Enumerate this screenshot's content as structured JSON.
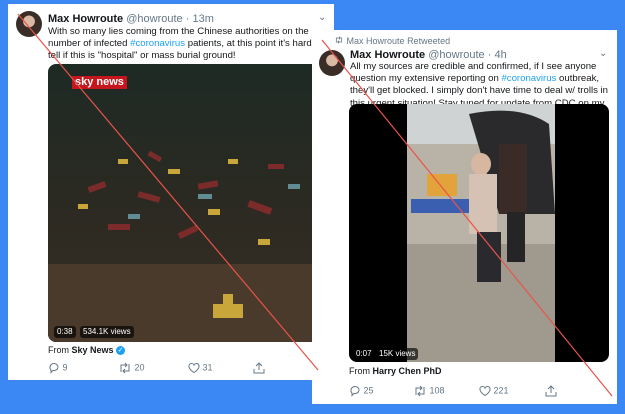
{
  "tweet1": {
    "author_name": "Max Howroute",
    "handle": "@howroute",
    "separator": "·",
    "time": "13m",
    "text_before": "With so many lies coming from the Chinese authorities on the number of infected ",
    "hashtag": "#coronavirus",
    "text_after": " patients, at this point it's hard to tell if this is \"hospital\" or mass burial ground!",
    "video_logo": "sky news",
    "video_duration": "0:38",
    "video_views": "534.1K views",
    "from_label": "From",
    "from_source": "Sky News",
    "verified_glyph": "✓",
    "replies": "9",
    "retweets": "20",
    "likes": "31"
  },
  "tweet2": {
    "retweet_label": "Max Howroute",
    "retweet_suffix": "Retweeted",
    "author_name": "Max Howroute",
    "handle": "@howroute",
    "separator": "·",
    "time": "4h",
    "text_before": "All my sources are credible and confirmed, if I see anyone question my extensive reporting on ",
    "hashtag": "#coronavirus",
    "text_after": " outbreak, they'll get blocked. I simply don't have time to deal w/ trolls in this urgent situation! Stay tuned for update from CDC on my main thread.",
    "video_duration": "0:07",
    "video_views": "15K views",
    "from_label": "From",
    "from_source": "Harry Chen PhD",
    "replies": "25",
    "retweets": "108",
    "likes": "221"
  },
  "colors": {
    "background": "#3b87f4",
    "link": "#1da1f2",
    "strike_line": "#e8534a"
  },
  "icons": [
    "reply-icon",
    "retweet-icon",
    "like-icon",
    "share-icon",
    "chevron-down-icon",
    "verified-icon"
  ]
}
